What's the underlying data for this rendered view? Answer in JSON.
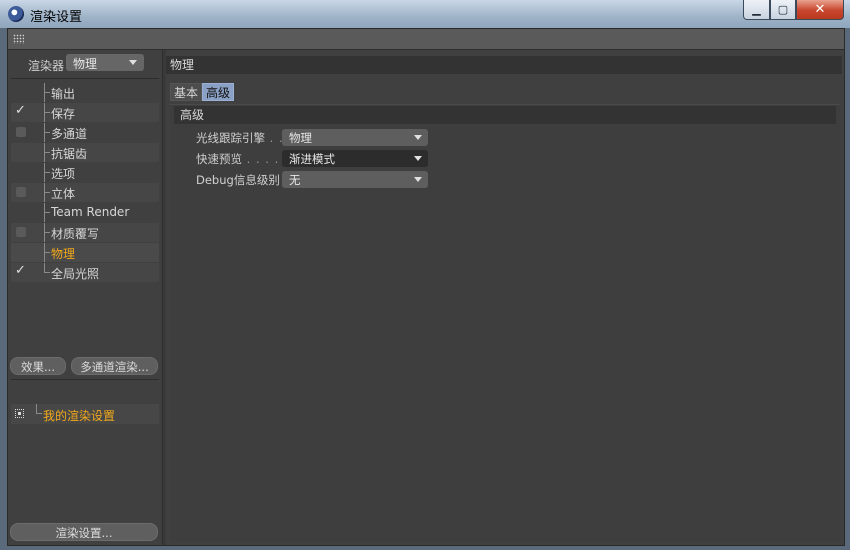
{
  "window": {
    "title": "渲染设置",
    "minimize": "▁",
    "maximize": "▢",
    "close": "✕"
  },
  "renderer": {
    "label": "渲染器",
    "value": "物理"
  },
  "sidebar": {
    "items": [
      {
        "label": "输出",
        "check": "none"
      },
      {
        "label": "保存",
        "check": "checked"
      },
      {
        "label": "多通道",
        "check": "box"
      },
      {
        "label": "抗锯齿",
        "check": "none"
      },
      {
        "label": "选项",
        "check": "none"
      },
      {
        "label": "立体",
        "check": "box"
      },
      {
        "label": "Team Render",
        "check": "none"
      },
      {
        "label": "材质覆写",
        "check": "box"
      },
      {
        "label": "物理",
        "check": "none",
        "active": true
      },
      {
        "label": "全局光照",
        "check": "checked"
      }
    ],
    "effects_button": "效果...",
    "multipass_button": "多通道渲染...",
    "preset": "我的渲染设置",
    "render_settings_button": "渲染设置..."
  },
  "main": {
    "section_title": "物理",
    "tabs": [
      {
        "label": "基本"
      },
      {
        "label": "高级",
        "active": true
      }
    ],
    "group_title": "高级",
    "params": [
      {
        "label": "光线跟踪引擎",
        "dots": " . .",
        "value": "物理"
      },
      {
        "label": "快速预览",
        "dots": " . . . . . .",
        "value": "渐进模式"
      },
      {
        "label": "Debug信息级别",
        "dots": "",
        "value": "无"
      }
    ]
  },
  "colors": {
    "accent_active_text": "#f2a91b",
    "tab_active_bg": "#8aa0c4",
    "panel_bg": "#404040"
  }
}
